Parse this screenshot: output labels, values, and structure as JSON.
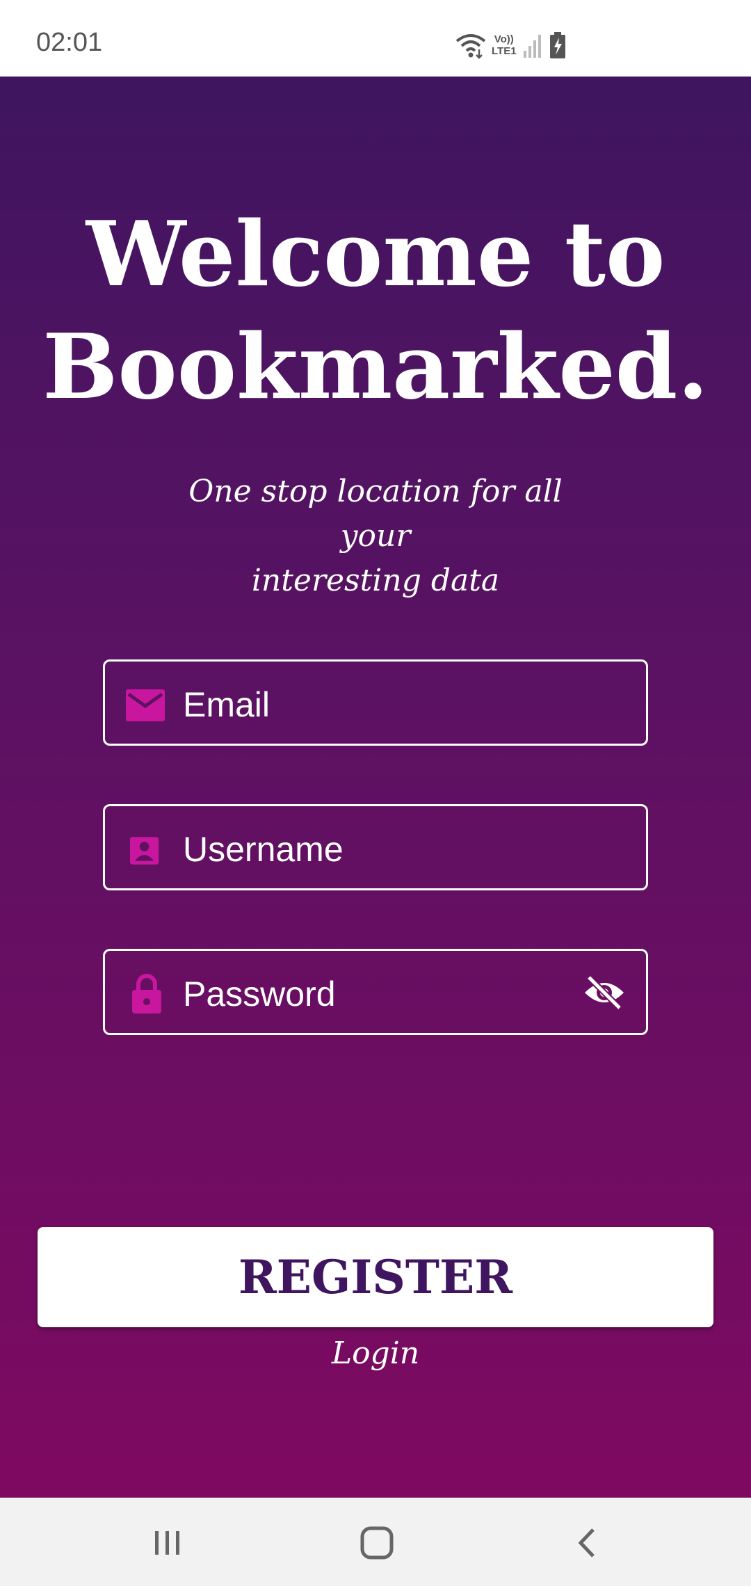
{
  "status_bar": {
    "time": "02:01",
    "network_label_top": "Vo))",
    "network_label_bottom": "LTE1",
    "icons": [
      "wifi-icon",
      "signal-icon",
      "battery-charging-icon"
    ]
  },
  "welcome": {
    "title_line1": "Welcome to",
    "title_line2": "Bookmarked.",
    "subtitle_line1": "One stop location for all your",
    "subtitle_line2": "interesting data"
  },
  "form": {
    "email_placeholder": "Email",
    "email_icon": "mail-icon",
    "username_placeholder": "Username",
    "username_icon": "account-box-icon",
    "password_placeholder": "Password",
    "password_icon": "lock-icon",
    "visibility_icon": "visibility-off-icon"
  },
  "actions": {
    "register_label": "REGISTER",
    "login_label": "Login"
  },
  "nav": {
    "icons": [
      "recents-icon",
      "home-icon",
      "back-icon"
    ]
  },
  "colors": {
    "gradient_top": "#3f1560",
    "gradient_bottom": "#7e0a60",
    "icon_accent": "#c9169e",
    "register_text": "#3f1560"
  }
}
